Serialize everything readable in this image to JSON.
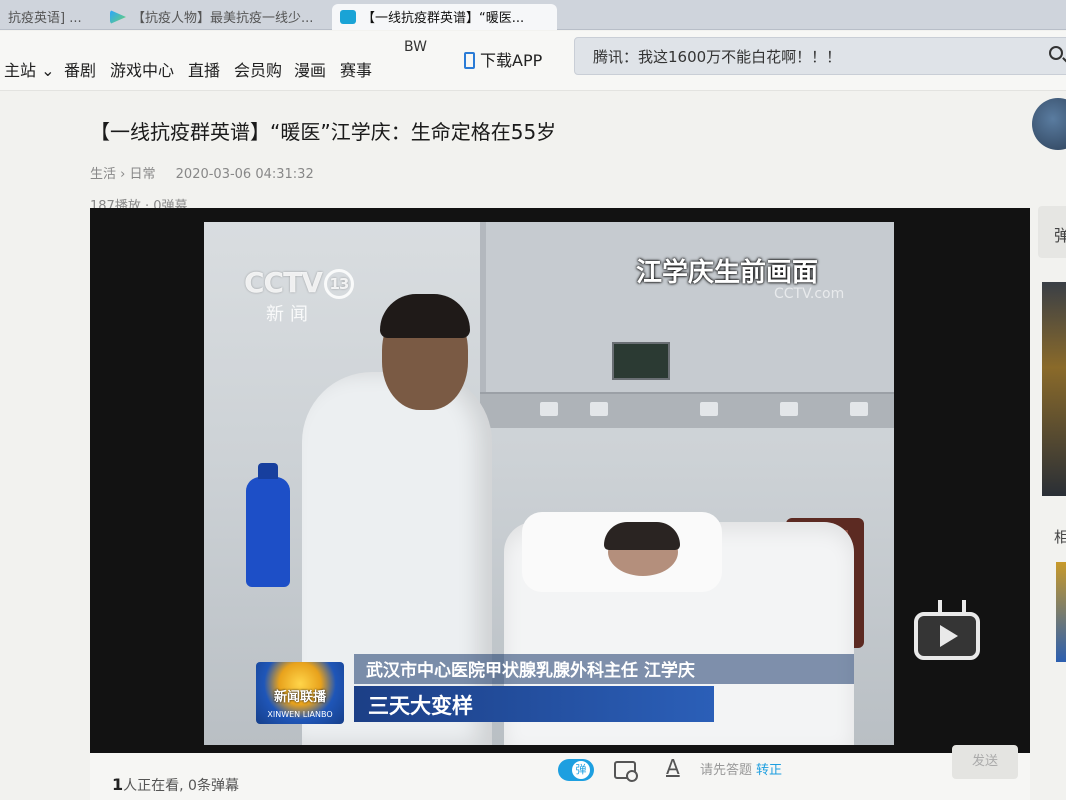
{
  "browser": {
    "tabs": [
      {
        "label": "抗疫英语] ...",
        "icon": "page-icon"
      },
      {
        "label": "【抗疫人物】最美抗疫一线少...",
        "icon": "video-play-icon"
      },
      {
        "label": "【一线抗疫群英谱】“暖医...",
        "icon": "bilibili-icon",
        "active": true
      }
    ]
  },
  "nav": {
    "items": [
      "主站",
      "番剧",
      "游戏中心",
      "直播",
      "会员购",
      "漫画",
      "赛事"
    ],
    "bw": "BW",
    "download_app": "下载APP",
    "search_text": "腾讯：我这1600万不能白花啊！！！"
  },
  "video": {
    "title": "【一线抗疫群英谱】“暖医”江学庆：生命定格在55岁",
    "category": "生活",
    "subcategory": "日常",
    "date": "2020-03-06 04:31:32",
    "plays": "187播放",
    "danmaku_count": "0弹幕"
  },
  "frame": {
    "cctv_logo": "CCTV",
    "cctv_channel": "13",
    "cctv_sub": "新闻",
    "caption_top": "江学庆生前画面",
    "caption_watermark": "CCTV.com",
    "lower_third_logo": "新闻联播",
    "lower_third_logo_sub": "XINWEN LIANBO",
    "lower_third_name": "武汉市中心医院甲状腺乳腺外科主任 江学庆",
    "lower_third_headline": "三天大变样"
  },
  "controls": {
    "viewers_count": "1",
    "viewers_text": "人正在看, 0条弹幕",
    "danmaku_toggle_label": "弹",
    "font_label": "A",
    "hint_text": "请先答题",
    "hint_link": "转正",
    "send_label": "发送"
  },
  "sidebar": {
    "tab_label": "弹",
    "section_label": "相"
  }
}
